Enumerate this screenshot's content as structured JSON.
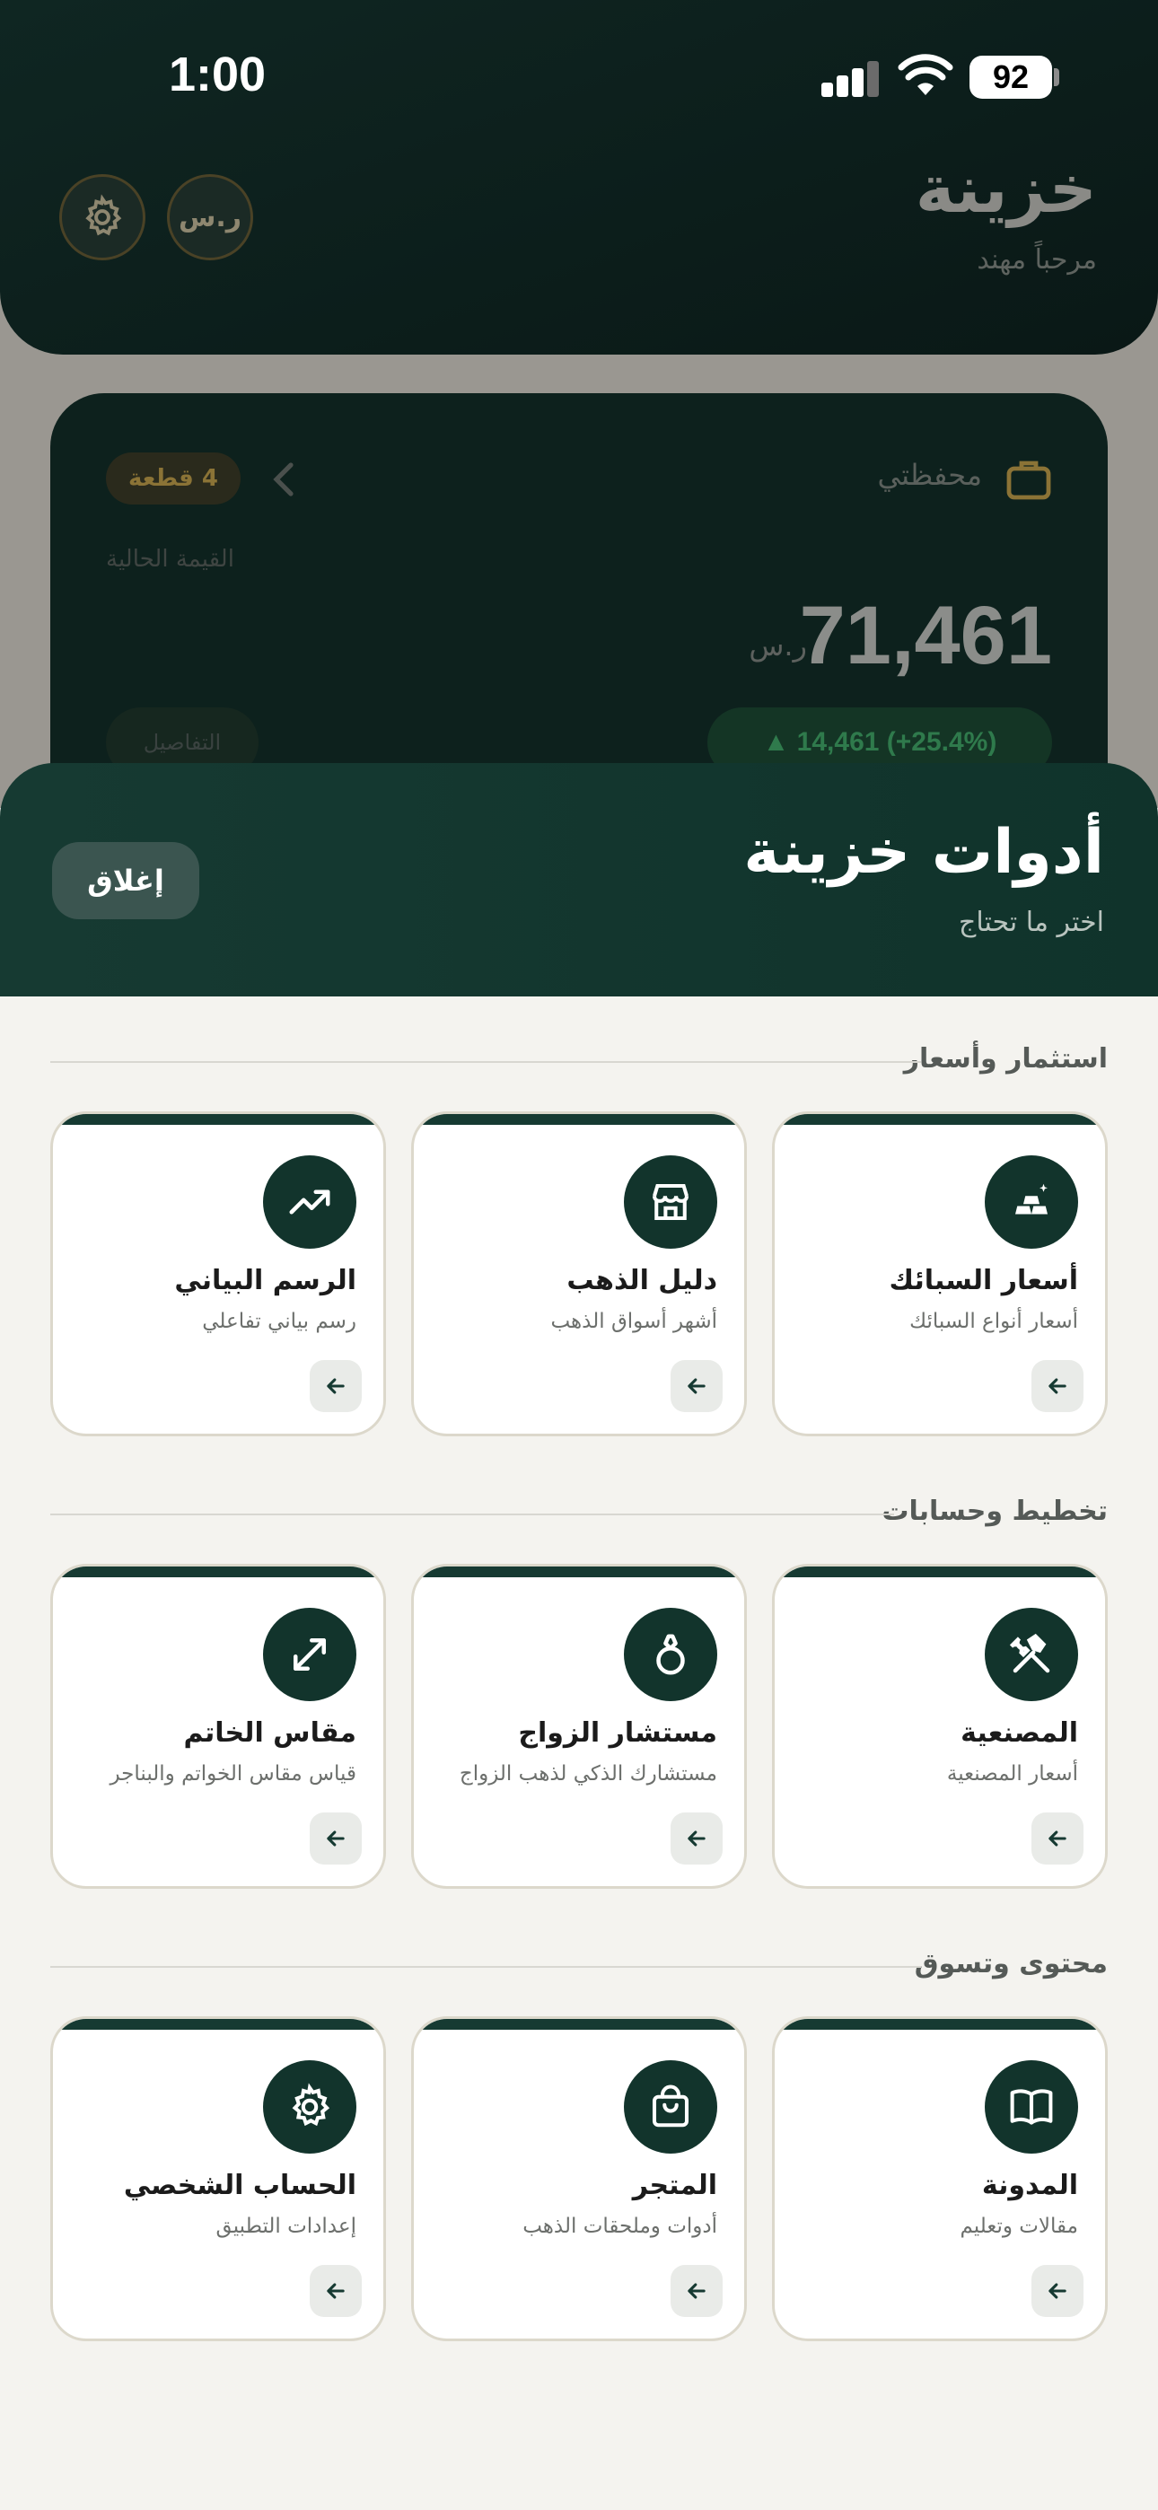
{
  "status_bar": {
    "time": "1:00",
    "battery": "92"
  },
  "app": {
    "title": "خزينة",
    "greeting": "مرحباً مهند",
    "currency_button": "ر.س"
  },
  "portfolio": {
    "title": "محفظتي",
    "badge": "4 قطعة",
    "current_value_label": "القيمة الحالية",
    "value": "71,461",
    "currency": "ر.س",
    "change": "▲ 14,461 (+25.4%)",
    "details_label": "التفاصيل"
  },
  "sheet": {
    "title": "أدوات خزينة",
    "subtitle": "اختر ما تحتاج",
    "close_label": "إغلاق"
  },
  "sections": [
    {
      "title": "استثمار وأسعار",
      "tools": [
        {
          "name": "أسعار السبائك",
          "desc": "أسعار أنواع السبائك",
          "icon": "gold-bars-icon"
        },
        {
          "name": "دليل الذهب",
          "desc": "أشهر أسواق الذهب",
          "icon": "store-icon"
        },
        {
          "name": "الرسم البياني",
          "desc": "رسم بياني تفاعلي",
          "icon": "trending-up-icon"
        }
      ]
    },
    {
      "title": "تخطيط وحسابات",
      "tools": [
        {
          "name": "المصنعية",
          "desc": "أسعار المصنعية",
          "icon": "tools-icon"
        },
        {
          "name": "مستشار الزواج",
          "desc": "مستشارك الذكي لذهب الزواج",
          "icon": "ring-icon"
        },
        {
          "name": "مقاس الخاتم",
          "desc": "قياس مقاس الخواتم والبناجر",
          "icon": "resize-icon"
        }
      ]
    },
    {
      "title": "محتوى وتسوق",
      "tools": [
        {
          "name": "المدونة",
          "desc": "مقالات وتعليم",
          "icon": "book-icon"
        },
        {
          "name": "المتجر",
          "desc": "أدوات وملحقات الذهب",
          "icon": "shopping-bag-icon"
        },
        {
          "name": "الحساب الشخصي",
          "desc": "إعدادات التطبيق",
          "icon": "gear-icon"
        }
      ]
    }
  ],
  "colors": {
    "accent": "#12342c",
    "gold": "#b38a2e",
    "positive": "#2f7a4c",
    "background": "#f4f3ef"
  }
}
